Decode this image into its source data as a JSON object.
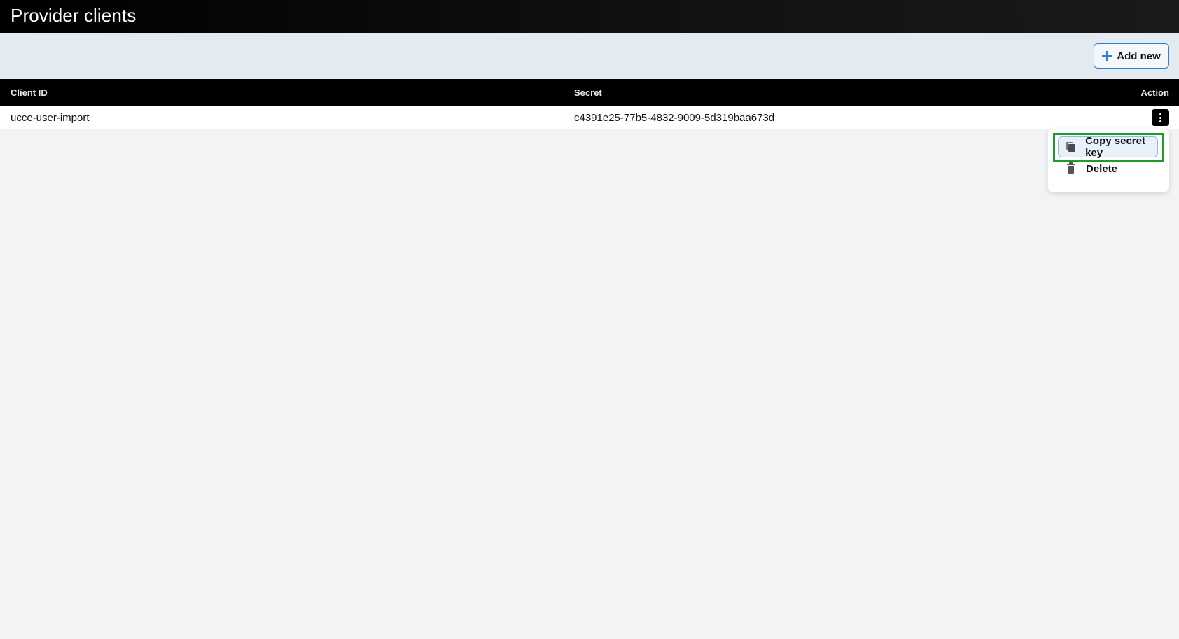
{
  "header": {
    "title": "Provider clients"
  },
  "toolbar": {
    "add_label": "Add new"
  },
  "table": {
    "columns": [
      "Client ID",
      "Secret",
      "Action"
    ],
    "rows": [
      {
        "client_id": "ucce-user-import",
        "secret": "c4391e25-77b5-4832-9009-5d319baa673d"
      }
    ]
  },
  "menu": {
    "items": [
      {
        "label": "Copy secret key",
        "icon": "copy-icon",
        "highlighted": true
      },
      {
        "label": "Delete",
        "icon": "trash-icon",
        "highlighted": false
      }
    ]
  },
  "colors": {
    "accent": "#2f7de1",
    "highlight_border": "#1f9a2b",
    "header_bg": "#000000",
    "toolbar_bg": "#e3ebf0"
  }
}
